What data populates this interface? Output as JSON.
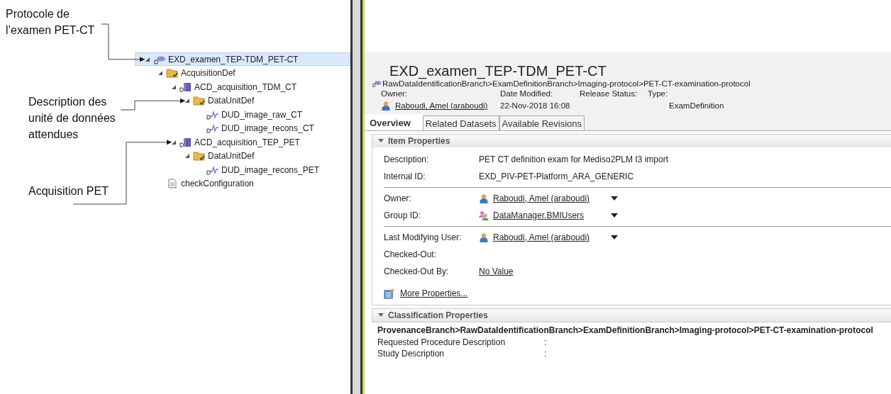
{
  "annotations": [
    {
      "text": "Protocole de l’examen PET-CT"
    },
    {
      "text": "Description des unité de données attendues"
    },
    {
      "text": "Acquisition PET"
    }
  ],
  "tree": [
    {
      "label": "EXD_examen_TEP-TDM_PET-CT",
      "kind": "exam",
      "expanded": true,
      "selected": true,
      "children": [
        {
          "label": "AcquisitionDef",
          "kind": "folder",
          "expanded": true,
          "selected": false,
          "children": [
            {
              "label": "ACD_acquisition_TDM_CT",
              "kind": "acquisition",
              "expanded": true,
              "selected": false,
              "children": [
                {
                  "label": "DataUnitDef",
                  "kind": "folder",
                  "expanded": true,
                  "selected": false,
                  "children": [
                    {
                      "label": "DUD_image_raw_CT",
                      "kind": "dataunit",
                      "selected": false
                    },
                    {
                      "label": "DUD_image_recons_CT",
                      "kind": "dataunit",
                      "selected": false
                    }
                  ]
                }
              ]
            },
            {
              "label": "ACD_acquisition_TEP_PET",
              "kind": "acquisition",
              "expanded": true,
              "selected": false,
              "children": [
                {
                  "label": "DataUnitDef",
                  "kind": "folder",
                  "expanded": true,
                  "selected": false,
                  "children": [
                    {
                      "label": "DUD_image_recons_PET",
                      "kind": "dataunit",
                      "selected": false
                    }
                  ]
                }
              ]
            }
          ]
        },
        {
          "label": "checkConfiguration",
          "kind": "file",
          "selected": false
        }
      ]
    }
  ],
  "detail": {
    "title": "EXD_examen_TEP-TDM_PET-CT",
    "breadcrumb": "RawDataIdentificationBranch>ExamDefinitionBranch>Imaging-protocol>PET-CT-examination-protocol",
    "header_fields": [
      {
        "label": "Owner:",
        "value": "Raboudi, Amel (araboudi)",
        "kind": "user"
      },
      {
        "label": "Date Modified:",
        "value": "22-Nov-2018 16:08",
        "kind": "text"
      },
      {
        "label": "Release Status:"
      },
      {
        "label": "Type:",
        "value": "ExamDefinition",
        "kind": "text"
      }
    ],
    "tabs": [
      {
        "label": "Overview",
        "selected": true
      },
      {
        "label": "Related Datasets",
        "selected": false
      },
      {
        "label": "Available Revisions",
        "selected": false
      }
    ],
    "item_properties": {
      "title": "Item Properties",
      "expanded": true,
      "groups": [
        [
          {
            "label": "Description:",
            "value": "PET CT definition exam for Mediso2PLM I3 import",
            "kind": "text"
          },
          {
            "label": "Internal ID:",
            "value": "EXD_PIV-PET-Platform_ARA_GENERIC",
            "kind": "text"
          }
        ],
        [
          {
            "label": "Owner:",
            "value": "Raboudi, Amel (araboudi)",
            "kind": "user",
            "has_menu": true
          },
          {
            "label": "Group ID:",
            "value": "DataManager.BMIUsers",
            "kind": "group",
            "has_menu": true
          }
        ],
        [
          {
            "label": "Last Modifying User:",
            "value": "Raboudi, Amel (araboudi)",
            "kind": "user",
            "has_menu": true
          },
          {
            "label": "Checked-Out:"
          },
          {
            "label": "Checked-Out By:",
            "value": "No Value",
            "kind": "link"
          }
        ]
      ],
      "more_link": "More Properties..."
    },
    "classification": {
      "title": "Classification Properties",
      "expanded": true,
      "path": "ProvenanceBranch>RawDataIdentificationBranch>ExamDefinitionBranch>Imaging-protocol>PET-CT-examination-protocol",
      "fields": [
        {
          "label": "Requested Procedure Description",
          "separator": ":"
        },
        {
          "label": "Study Description",
          "separator": ":"
        }
      ]
    }
  }
}
